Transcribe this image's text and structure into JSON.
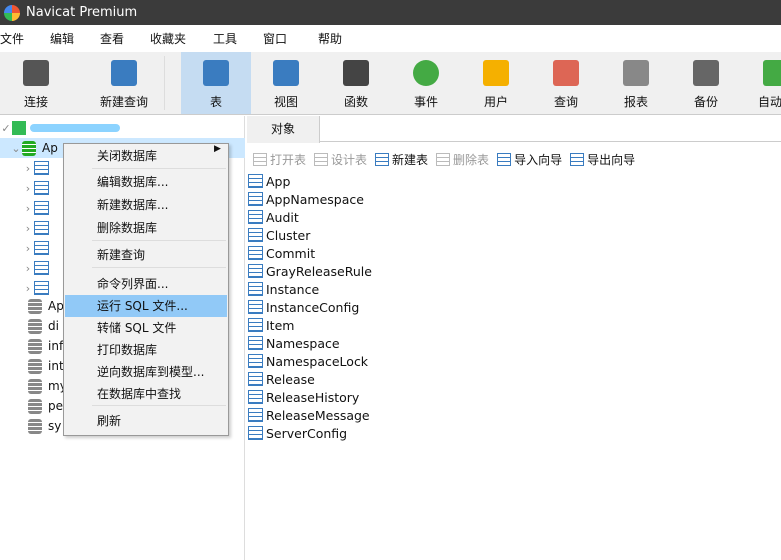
{
  "window": {
    "title": "Navicat Premium"
  },
  "menu": [
    "文件",
    "编辑",
    "查看",
    "收藏夹",
    "工具",
    "窗口",
    "帮助"
  ],
  "toolbar": [
    {
      "label": "连接",
      "icon": "plug-icon"
    },
    {
      "label": "新建查询",
      "icon": "new-query-icon"
    },
    {
      "label": "表",
      "icon": "table-icon",
      "selected": true
    },
    {
      "label": "视图",
      "icon": "view-icon"
    },
    {
      "label": "函数",
      "icon": "function-icon"
    },
    {
      "label": "事件",
      "icon": "clock-icon"
    },
    {
      "label": "用户",
      "icon": "user-icon"
    },
    {
      "label": "查询",
      "icon": "query-icon"
    },
    {
      "label": "报表",
      "icon": "report-icon"
    },
    {
      "label": "备份",
      "icon": "backup-icon"
    },
    {
      "label": "自动运",
      "icon": "automation-icon"
    }
  ],
  "tree": {
    "db_selected": "Ap",
    "databases": [
      "Ap",
      "di",
      "inf",
      "int",
      "my",
      "pe",
      "sy"
    ]
  },
  "context_menu": [
    "关闭数据库",
    "编辑数据库...",
    "新建数据库...",
    "删除数据库",
    "新建查询",
    "命令列界面...",
    "运行 SQL 文件...",
    "转储 SQL 文件",
    "打印数据库",
    "逆向数据库到模型...",
    "在数据库中查找",
    "刷新"
  ],
  "context_highlight": "运行 SQL 文件...",
  "objects": {
    "tab": "对象",
    "toolbar": [
      "打开表",
      "设计表",
      "新建表",
      "删除表",
      "导入向导",
      "导出向导"
    ],
    "tables": [
      "App",
      "AppNamespace",
      "Audit",
      "Cluster",
      "Commit",
      "GrayReleaseRule",
      "Instance",
      "InstanceConfig",
      "Item",
      "Namespace",
      "NamespaceLock",
      "Release",
      "ReleaseHistory",
      "ReleaseMessage",
      "ServerConfig"
    ]
  }
}
